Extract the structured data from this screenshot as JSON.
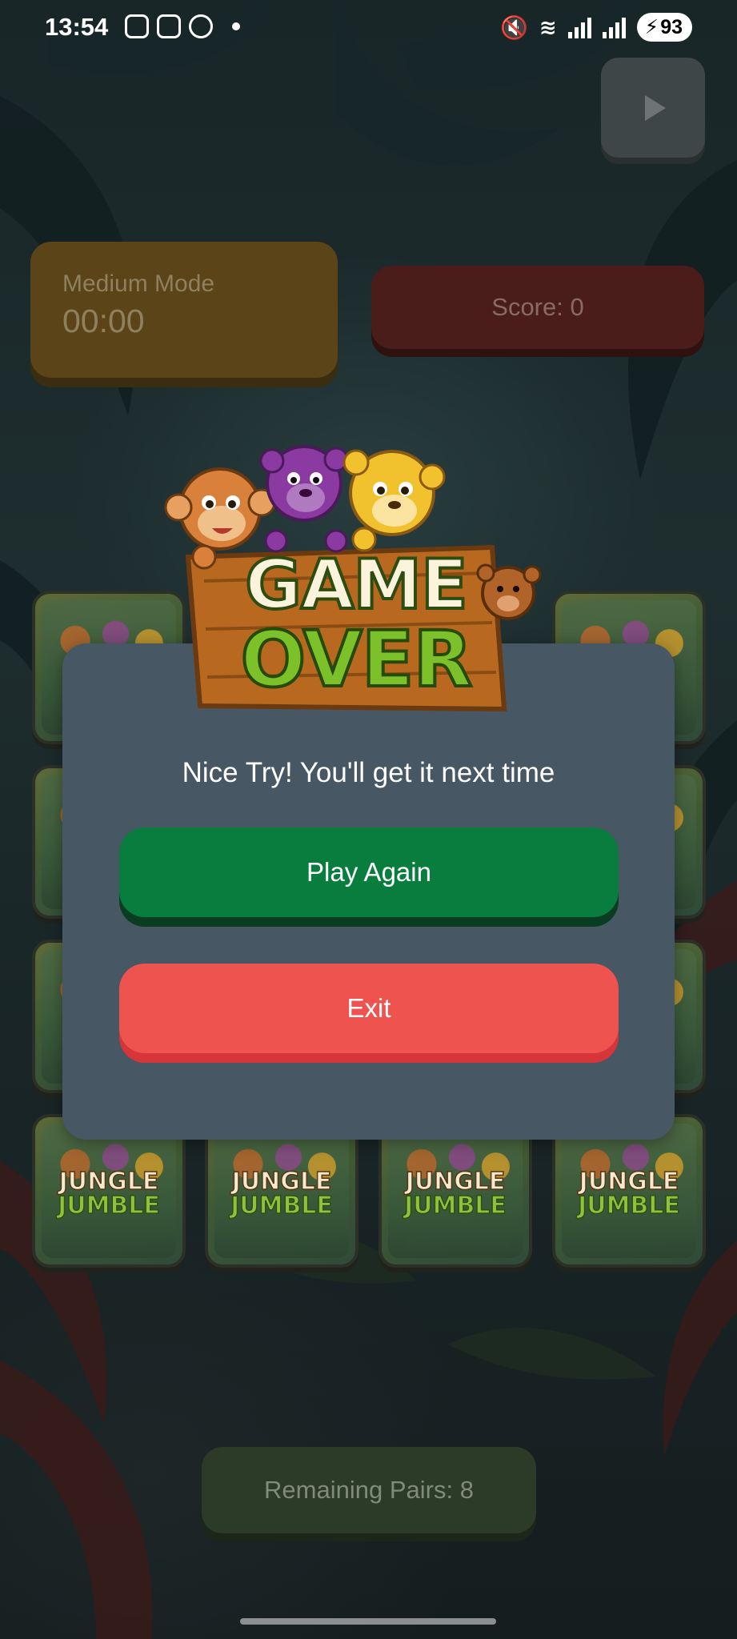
{
  "status_bar": {
    "time": "13:54",
    "battery": "93",
    "icons_left": [
      "screenshot-icon",
      "accessibility-icon",
      "vpn-icon",
      "notification-dot"
    ],
    "icons_right": [
      "mute-icon",
      "wifi-icon",
      "signal-icon",
      "signal-icon",
      "battery-icon"
    ]
  },
  "header": {
    "mode_label": "Medium Mode",
    "timer": "00:00",
    "score": "Score: 0",
    "play_icon": "play-icon"
  },
  "board": {
    "card_logo_line1": "JUNGLE",
    "card_logo_line2": "JUMBLE",
    "rows": 4,
    "cols": 4
  },
  "modal": {
    "logo_line1": "GAME",
    "logo_line2": "OVER",
    "message": "Nice Try! You'll get it next time",
    "play_again_label": "Play Again",
    "exit_label": "Exit"
  },
  "footer": {
    "remaining_pairs": "Remaining Pairs: 8"
  },
  "colors": {
    "modal_bg": "#475763",
    "play_again": "#087d3e",
    "exit": "#ef5350",
    "mode_panel": "#5a4418",
    "score_panel": "#4b1d1a",
    "pairs_panel": "#2b3b27"
  }
}
